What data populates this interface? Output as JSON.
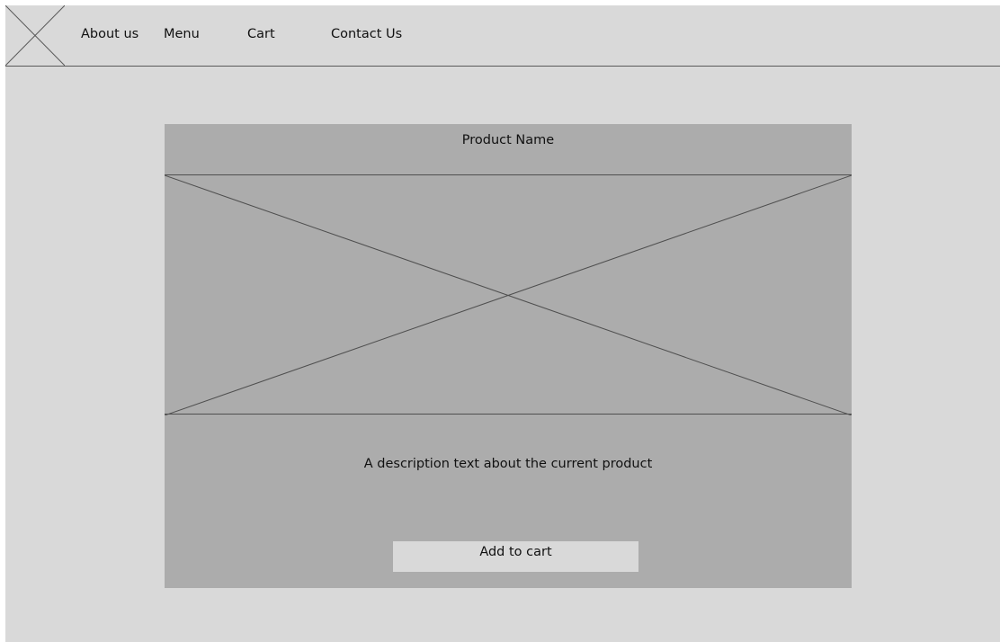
{
  "nav": {
    "logo_icon": "placeholder-cross-icon",
    "links": [
      {
        "label": "About us"
      },
      {
        "label": "Menu"
      },
      {
        "label": "Cart"
      },
      {
        "label": "Contact Us"
      }
    ]
  },
  "product": {
    "name": "Product Name",
    "image_icon": "image-placeholder-icon",
    "description": "A description text about the current product",
    "add_to_cart_label": "Add to cart"
  },
  "colors": {
    "page_background": "#d9d9d9",
    "card_background": "#acacac",
    "button_background": "#d9d9d9",
    "line_color": "#4f4f4f"
  }
}
